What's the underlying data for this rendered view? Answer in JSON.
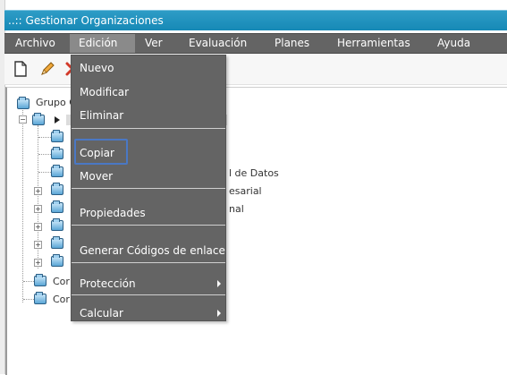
{
  "window": {
    "title": "..:: Gestionar Organizaciones"
  },
  "menubar": {
    "items": [
      "Archivo",
      "Edición",
      "Ver",
      "Evaluación",
      "Planes",
      "Herramientas",
      "Ayuda"
    ],
    "active": "Edición"
  },
  "toolbar": {
    "buttons": [
      "new-document-icon",
      "edit-pencil-icon",
      "delete-icon"
    ]
  },
  "tree": {
    "root_label": "Grupo C",
    "partial_labels": [
      "l de Datos",
      "esarial",
      "nal"
    ],
    "bottom_labels": [
      "Cor",
      "Cor"
    ]
  },
  "edit_menu": {
    "items": [
      {
        "label": "Nuevo"
      },
      {
        "label": "Modificar"
      },
      {
        "label": "Eliminar"
      },
      {
        "label": "Copiar",
        "focused": true
      },
      {
        "label": "Mover"
      },
      {
        "label": "Propiedades"
      },
      {
        "label": "Generar Códigos de enlace"
      },
      {
        "label": "Protección",
        "submenu": true
      },
      {
        "label": "Calcular",
        "submenu": true
      }
    ]
  },
  "colors": {
    "titlebar": "#1f93c0",
    "menubar": "#646464",
    "focus_ring": "#4a78c4"
  }
}
